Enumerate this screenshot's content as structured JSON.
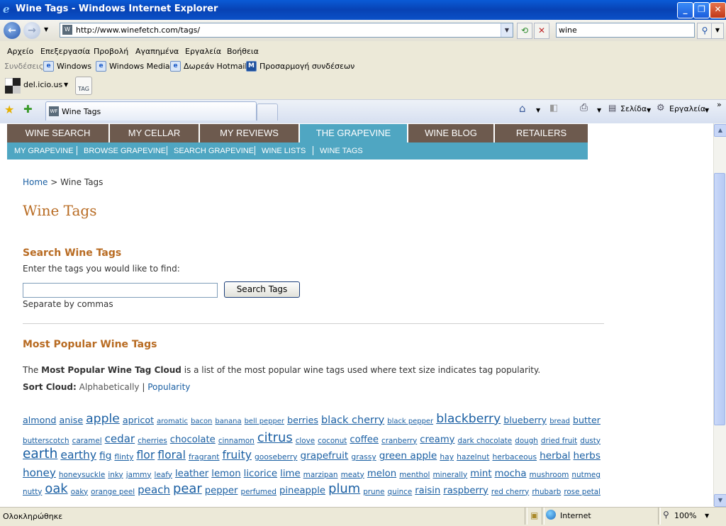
{
  "window": {
    "title": "Wine Tags - Windows Internet Explorer"
  },
  "address": {
    "url": "http://www.winefetch.com/tags/"
  },
  "search": {
    "value": "wine"
  },
  "menu": [
    "Αρχείο",
    "Επεξεργασία",
    "Προβολή",
    "Αγαπημένα",
    "Εργαλεία",
    "Βοήθεια"
  ],
  "links": {
    "label": "Συνδέσεις",
    "items": [
      "Windows",
      "Windows Media",
      "Δωρεάν Hotmail",
      "Προσαρμογή συνδέσεων"
    ]
  },
  "delicious": {
    "label": "del.icio.us",
    "tag": "TAG"
  },
  "tab": {
    "title": "Wine Tags"
  },
  "commands": {
    "page": "Σελίδα",
    "tools": "Εργαλεία"
  },
  "site": {
    "nav": [
      "WINE SEARCH",
      "MY CELLAR",
      "MY REVIEWS",
      "THE GRAPEVINE",
      "WINE BLOG",
      "RETAILERS"
    ],
    "subnav": [
      "MY GRAPEVINE",
      "BROWSE GRAPEVINE",
      "SEARCH GRAPEVINE",
      "WINE LISTS",
      "WINE TAGS"
    ],
    "breadcrumb": {
      "home": "Home",
      "sep": " > ",
      "current": "Wine Tags"
    },
    "title": "Wine Tags",
    "search_heading": "Search Wine Tags",
    "search_prompt": "Enter the tags you would like to find:",
    "search_button": "Search Tags",
    "search_hint": "Separate by commas",
    "popular_heading": "Most Popular Wine Tags",
    "popular_desc_pre": "The ",
    "popular_desc_bold": "Most Popular Wine Tag Cloud",
    "popular_desc_post": " is a list of the most popular wine tags used where text size indicates tag popularity.",
    "sort_label": "Sort Cloud:",
    "sort_alpha": "Alphabetically",
    "sort_sep": "|",
    "sort_pop": "Popularity"
  },
  "tag_rows": [
    [
      [
        "almond",
        1
      ],
      [
        "anise",
        1
      ],
      [
        "apple",
        3
      ],
      [
        "apricot",
        1
      ],
      [
        "aromatic",
        0
      ],
      [
        "bacon",
        0
      ],
      [
        "banana",
        0
      ],
      [
        "bell pepper",
        0
      ],
      [
        "berries",
        1
      ],
      [
        "black cherry",
        2
      ],
      [
        "black pepper",
        0
      ],
      [
        "blackberry",
        3
      ],
      [
        "blueberry",
        1
      ],
      [
        "bread",
        0
      ],
      [
        "butter",
        1
      ]
    ],
    [
      [
        "butterscotch",
        0
      ],
      [
        "caramel",
        0
      ],
      [
        "cedar",
        2
      ],
      [
        "cherries",
        0
      ],
      [
        "chocolate",
        1
      ],
      [
        "cinnamon",
        0
      ],
      [
        "citrus",
        3
      ],
      [
        "clove",
        0
      ],
      [
        "coconut",
        0
      ],
      [
        "coffee",
        1
      ],
      [
        "cranberry",
        0
      ],
      [
        "creamy",
        1
      ],
      [
        "dark chocolate",
        0
      ],
      [
        "dough",
        0
      ],
      [
        "dried fruit",
        0
      ],
      [
        "dusty",
        0
      ]
    ],
    [
      [
        "earth",
        3
      ],
      [
        "earthy",
        2
      ],
      [
        "fig",
        1
      ],
      [
        "flinty",
        0
      ],
      [
        "flor",
        2
      ],
      [
        "floral",
        2
      ],
      [
        "fragrant",
        0
      ],
      [
        "fruity",
        2
      ],
      [
        "gooseberry",
        0
      ],
      [
        "grapefruit",
        1
      ],
      [
        "grassy",
        0
      ],
      [
        "green apple",
        1
      ],
      [
        "hay",
        0
      ],
      [
        "hazelnut",
        0
      ],
      [
        "herbaceous",
        0
      ],
      [
        "herbal",
        1
      ],
      [
        "herbs",
        1
      ]
    ],
    [
      [
        "honey",
        2
      ],
      [
        "honeysuckle",
        0
      ],
      [
        "inky",
        0
      ],
      [
        "jammy",
        0
      ],
      [
        "leafy",
        0
      ],
      [
        "leather",
        1
      ],
      [
        "lemon",
        1
      ],
      [
        "licorice",
        1
      ],
      [
        "lime",
        1
      ],
      [
        "marzipan",
        0
      ],
      [
        "meaty",
        0
      ],
      [
        "melon",
        1
      ],
      [
        "menthol",
        0
      ],
      [
        "minerally",
        0
      ],
      [
        "mint",
        1
      ],
      [
        "mocha",
        1
      ],
      [
        "mushroom",
        0
      ],
      [
        "nutmeg",
        0
      ]
    ],
    [
      [
        "nutty",
        0
      ],
      [
        "oak",
        3
      ],
      [
        "oaky",
        0
      ],
      [
        "orange peel",
        0
      ],
      [
        "peach",
        2
      ],
      [
        "pear",
        3
      ],
      [
        "pepper",
        1
      ],
      [
        "perfumed",
        0
      ],
      [
        "pineapple",
        1
      ],
      [
        "plum",
        3
      ],
      [
        "prune",
        0
      ],
      [
        "quince",
        0
      ],
      [
        "raisin",
        1
      ],
      [
        "raspberry",
        1
      ],
      [
        "red cherry",
        0
      ],
      [
        "rhubarb",
        0
      ],
      [
        "rose petal",
        0
      ]
    ]
  ],
  "status": {
    "text": "Ολοκληρώθηκε",
    "zone": "Internet",
    "zoom": "100%"
  }
}
